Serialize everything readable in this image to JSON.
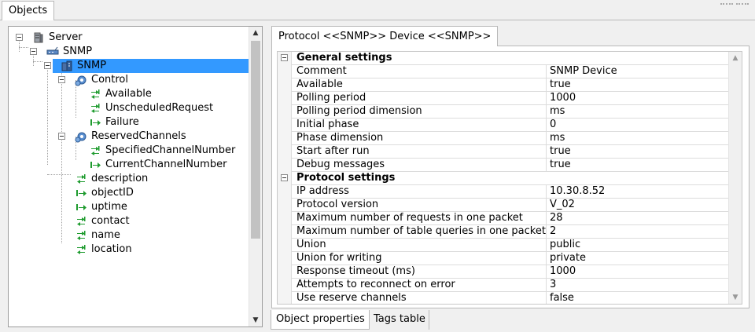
{
  "top_tab": {
    "label": "Objects"
  },
  "tree": {
    "nodes": [
      {
        "label": "Server",
        "icon": "server-icon"
      },
      {
        "label": "SNMP",
        "icon": "network-icon"
      },
      {
        "label": "SNMP",
        "icon": "device-icon",
        "selected": true
      },
      {
        "label": "Control",
        "icon": "gear-group-icon"
      },
      {
        "label": "Available",
        "icon": "tag-read-icon"
      },
      {
        "label": "UnscheduledRequest",
        "icon": "tag-read-icon"
      },
      {
        "label": "Failure",
        "icon": "tag-write-icon"
      },
      {
        "label": "ReservedChannels",
        "icon": "gear-group-icon"
      },
      {
        "label": "SpecifiedChannelNumber",
        "icon": "tag-read-icon"
      },
      {
        "label": "CurrentChannelNumber",
        "icon": "tag-write-icon"
      },
      {
        "label": "description",
        "icon": "tag-read-icon"
      },
      {
        "label": "objectID",
        "icon": "tag-write-icon"
      },
      {
        "label": "uptime",
        "icon": "tag-write-icon"
      },
      {
        "label": "contact",
        "icon": "tag-read-icon"
      },
      {
        "label": "name",
        "icon": "tag-read-icon"
      },
      {
        "label": "location",
        "icon": "tag-read-icon"
      }
    ]
  },
  "protocol_tab": {
    "label": "Protocol <<SNMP>> Device <<SNMP>>"
  },
  "properties": {
    "general_title": "General settings",
    "general": [
      {
        "name": "Comment",
        "value": "SNMP Device"
      },
      {
        "name": "Available",
        "value": "true"
      },
      {
        "name": "Polling period",
        "value": "1000"
      },
      {
        "name": "Polling period dimension",
        "value": "ms"
      },
      {
        "name": "Initial phase",
        "value": "0"
      },
      {
        "name": "Phase dimension",
        "value": "ms"
      },
      {
        "name": "Start after run",
        "value": "true"
      },
      {
        "name": "Debug messages",
        "value": "true"
      }
    ],
    "protocol_title": "Protocol settings",
    "protocol": [
      {
        "name": "IP address",
        "value": "10.30.8.52"
      },
      {
        "name": "Protocol version",
        "value": "V_02"
      },
      {
        "name": "Maximum number of requests in one packet",
        "value": "28"
      },
      {
        "name": "Maximum number of table queries in one packet",
        "value": "2"
      },
      {
        "name": "Union",
        "value": "public"
      },
      {
        "name": "Union for writing",
        "value": "private"
      },
      {
        "name": "Response timeout (ms)",
        "value": "1000"
      },
      {
        "name": "Attempts to reconnect on error",
        "value": "3"
      },
      {
        "name": "Use reserve channels",
        "value": "false"
      }
    ]
  },
  "bottom_tabs": {
    "active": "Object properties",
    "inactive": "Tags table"
  },
  "colors": {
    "selection": "#3399ff",
    "tag_green": "#1e9b2e"
  }
}
